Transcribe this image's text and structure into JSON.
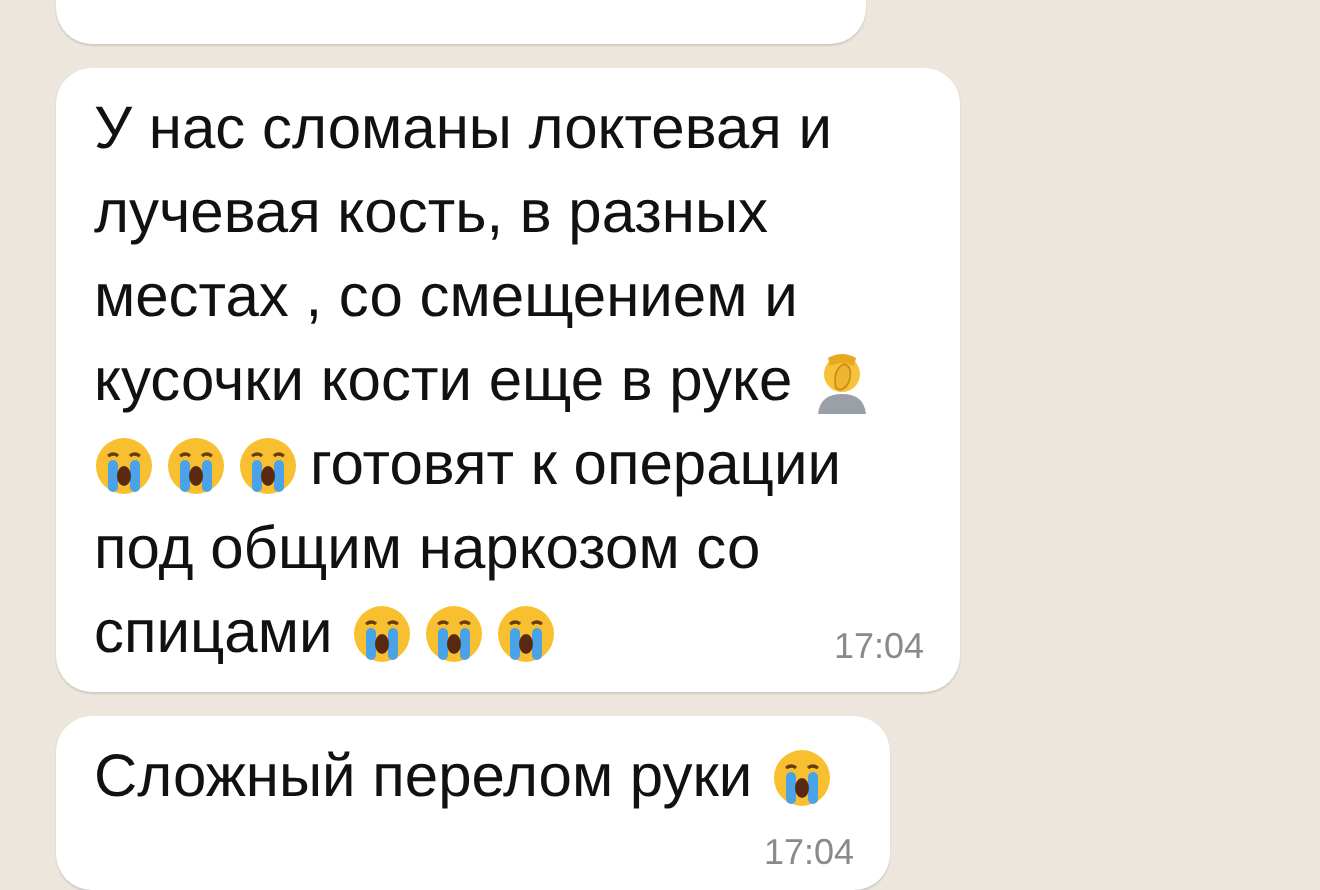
{
  "messages": [
    {
      "lines": [
        [
          {
            "kind": "text",
            "text": "У нас сломаны локтевая и"
          }
        ],
        [
          {
            "kind": "text",
            "text": "лучевая кость, в разных"
          }
        ],
        [
          {
            "kind": "text",
            "text": "местах , со смещением и"
          }
        ],
        [
          {
            "kind": "text",
            "text": "кусочки кости еще в руке"
          },
          {
            "kind": "facepalm"
          }
        ],
        [
          {
            "kind": "crying"
          },
          {
            "kind": "crying"
          },
          {
            "kind": "crying"
          },
          {
            "kind": "text",
            "text": "готовят к операции"
          }
        ],
        [
          {
            "kind": "text",
            "text": "под общим наркозом со"
          }
        ],
        [
          {
            "kind": "text",
            "text": "спицами"
          },
          {
            "kind": "crying"
          },
          {
            "kind": "crying"
          },
          {
            "kind": "crying"
          }
        ]
      ],
      "time": "17:04"
    },
    {
      "lines": [
        [
          {
            "kind": "text",
            "text": "Сложный перелом руки"
          },
          {
            "kind": "crying"
          }
        ]
      ],
      "time": "17:04"
    }
  ]
}
